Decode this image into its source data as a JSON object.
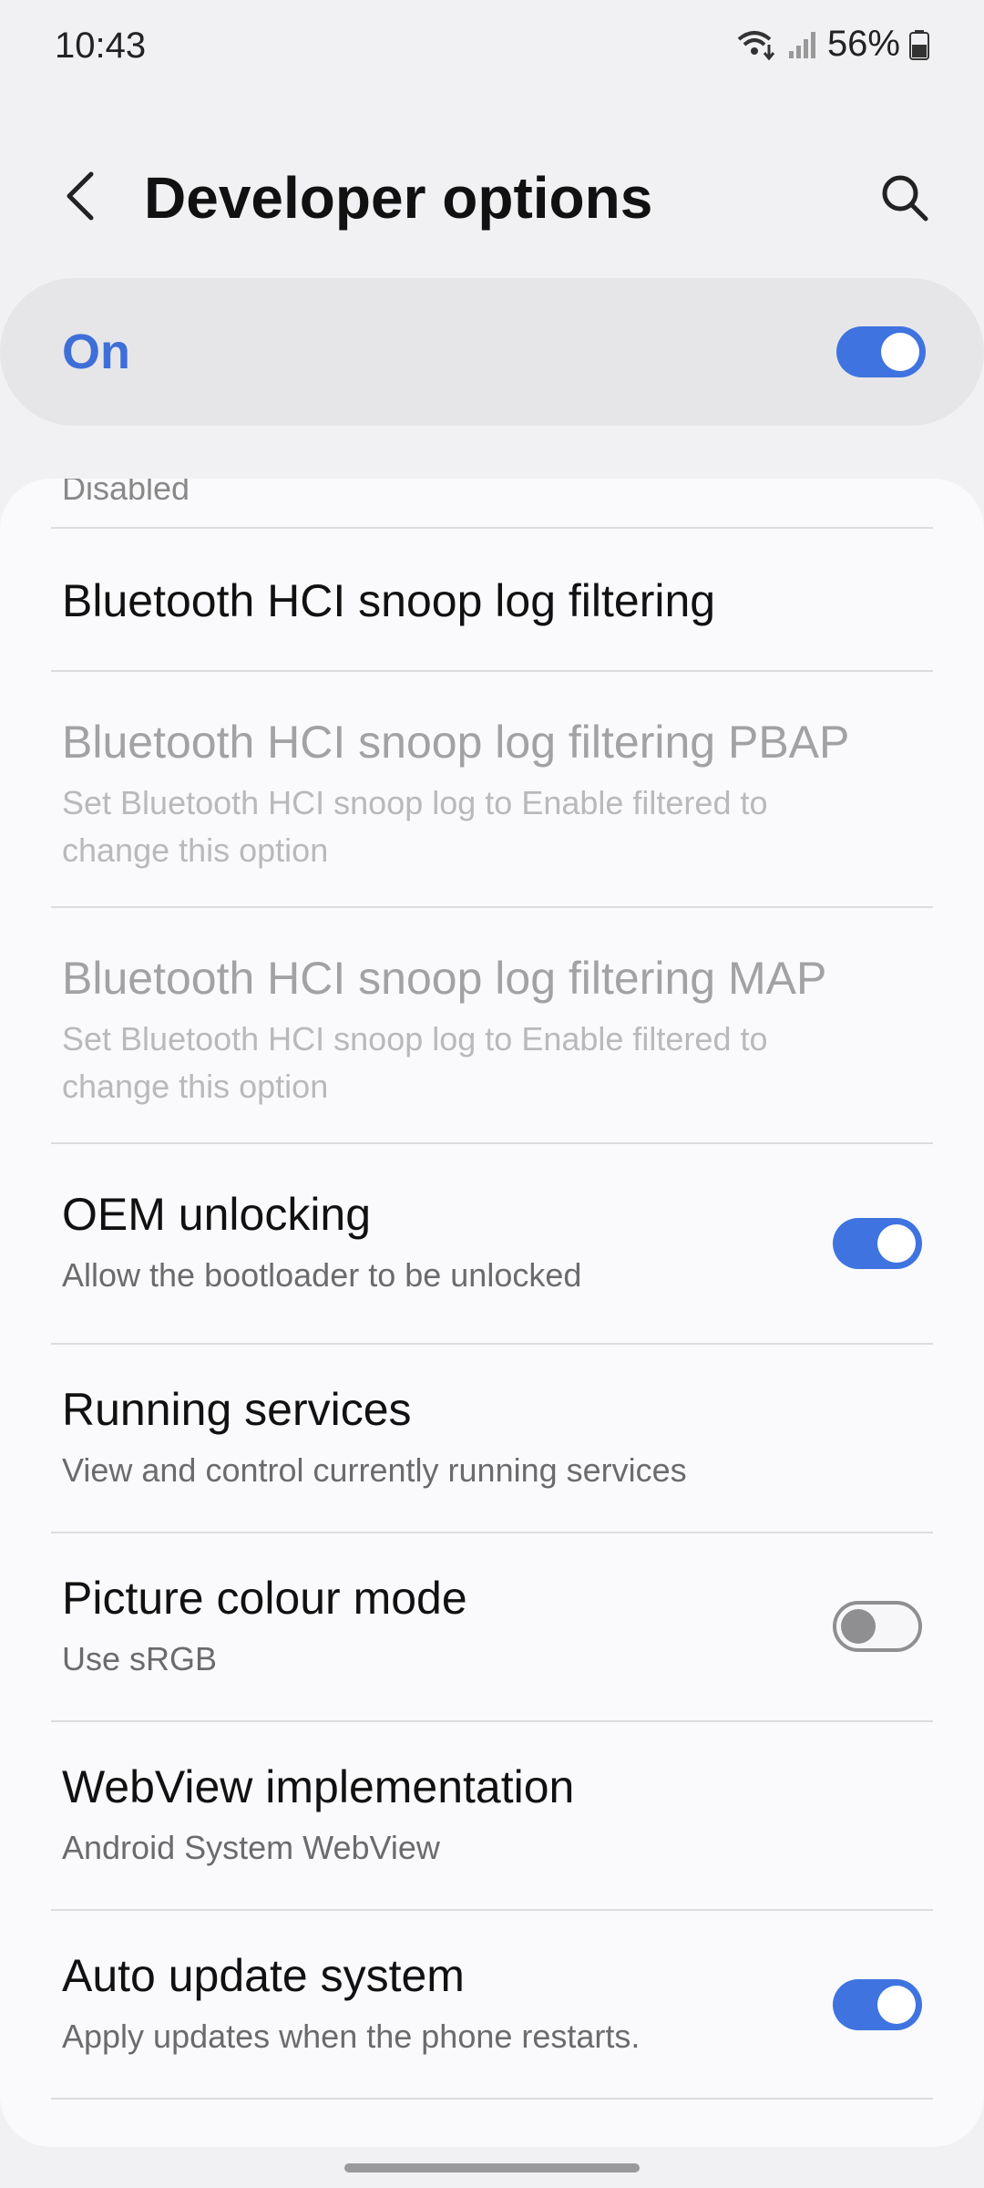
{
  "status_bar": {
    "time": "10:43",
    "battery_percent": "56%",
    "icons": [
      "wifi-call-icon",
      "signal-icon",
      "battery-icon"
    ]
  },
  "header": {
    "title": "Developer options",
    "back_icon": "back-arrow-icon",
    "search_icon": "search-icon"
  },
  "master_switch": {
    "label": "On",
    "state": true
  },
  "list": {
    "clipped_item": "Disabled",
    "items": [
      {
        "title": "Bluetooth HCI snoop log filtering",
        "subtitle": "",
        "disabled": false,
        "toggle": null
      },
      {
        "title": "Bluetooth HCI snoop log filtering PBAP",
        "subtitle": "Set Bluetooth HCI snoop log to Enable filtered to change this option",
        "disabled": true,
        "toggle": null
      },
      {
        "title": "Bluetooth HCI snoop log filtering MAP",
        "subtitle": "Set Bluetooth HCI snoop log to Enable filtered to change this option",
        "disabled": true,
        "toggle": null
      },
      {
        "title": "OEM unlocking",
        "subtitle": "Allow the bootloader to be unlocked",
        "disabled": false,
        "toggle": true
      },
      {
        "title": "Running services",
        "subtitle": "View and control currently running services",
        "disabled": false,
        "toggle": null
      },
      {
        "title": "Picture colour mode",
        "subtitle": "Use sRGB",
        "disabled": false,
        "toggle": false
      },
      {
        "title": "WebView implementation",
        "subtitle": "Android System WebView",
        "disabled": false,
        "toggle": null
      },
      {
        "title": "Auto update system",
        "subtitle": "Apply updates when the phone restarts.",
        "disabled": false,
        "toggle": true
      }
    ]
  },
  "colors": {
    "accent": "#3e73e0",
    "background": "#f1f1f3",
    "card": "#fafafc"
  }
}
